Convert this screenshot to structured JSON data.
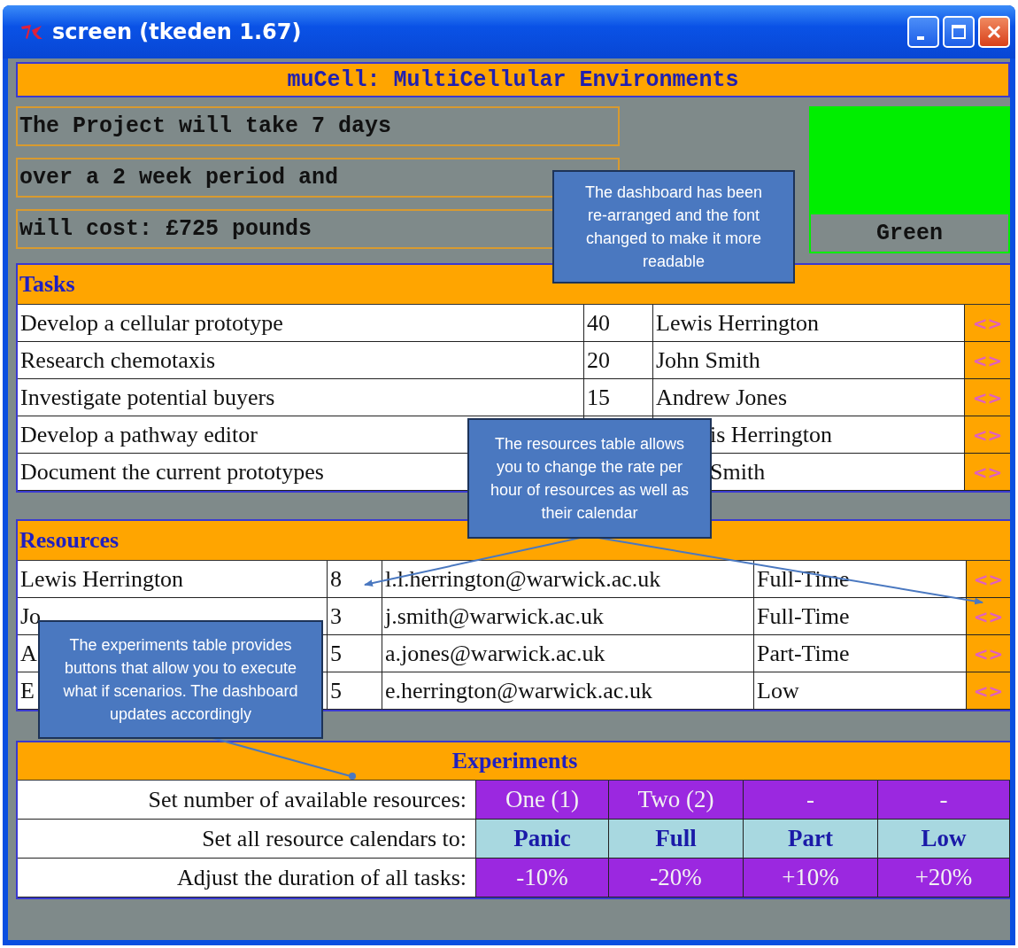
{
  "window": {
    "title": "screen (tkeden 1.67)"
  },
  "header": "muCell: MultiCellular Environments",
  "summary": [
    "The Project will take 7 days",
    "over a 2 week period and",
    "will cost: £725 pounds"
  ],
  "status": {
    "label": "Green",
    "color": "#00ee00"
  },
  "tasks": {
    "title": "Tasks",
    "rows": [
      {
        "name": "Develop a cellular prototype",
        "hours": "40",
        "person": "Lewis Herrington",
        "button": "<>"
      },
      {
        "name": "Research chemotaxis",
        "hours": "20",
        "person": "John Smith",
        "button": "<>"
      },
      {
        "name": "Investigate potential buyers",
        "hours": "15",
        "person": "Andrew Jones",
        "button": "<>"
      },
      {
        "name": "Develop a pathway editor",
        "person": "is Herrington",
        "button": "<>"
      },
      {
        "name": "Document the current prototypes",
        "person": "Smith",
        "button": "<>"
      }
    ]
  },
  "resources": {
    "title": "Resources",
    "rows": [
      {
        "name": "Lewis Herrington",
        "rate": "8",
        "email": "l.l.herrington@warwick.ac.uk",
        "calendar": "Full-Time",
        "button": "<>"
      },
      {
        "name": "Jo",
        "rate": "3",
        "email": "j.smith@warwick.ac.uk",
        "calendar": "Full-Time",
        "button": "<>"
      },
      {
        "name": "A",
        "rate": "5",
        "email": "a.jones@warwick.ac.uk",
        "calendar": "Part-Time",
        "button": "<>"
      },
      {
        "name": "E",
        "rate": "5",
        "email": "e.herrington@warwick.ac.uk",
        "calendar": "Low",
        "button": "<>"
      }
    ]
  },
  "experiments": {
    "title": "Experiments",
    "rows": [
      {
        "label": "Set number of available resources:",
        "kind": "purple",
        "buttons": [
          "One (1)",
          "Two (2)",
          "-",
          "-"
        ]
      },
      {
        "label": "Set all resource calendars to:",
        "kind": "calendar",
        "buttons": [
          "Panic",
          "Full",
          "Part",
          "Low"
        ]
      },
      {
        "label": "Adjust the duration of all tasks:",
        "kind": "purple",
        "buttons": [
          "-10%",
          "-20%",
          "+10%",
          "+20%"
        ]
      }
    ]
  },
  "callouts": [
    "The dashboard has been re-arranged and the font changed to make it more readable",
    "The resources table allows you to change the rate per hour of resources as well as their calendar",
    "The experiments table provides buttons that allow you to execute what if scenarios. The dashboard updates accordingly"
  ]
}
